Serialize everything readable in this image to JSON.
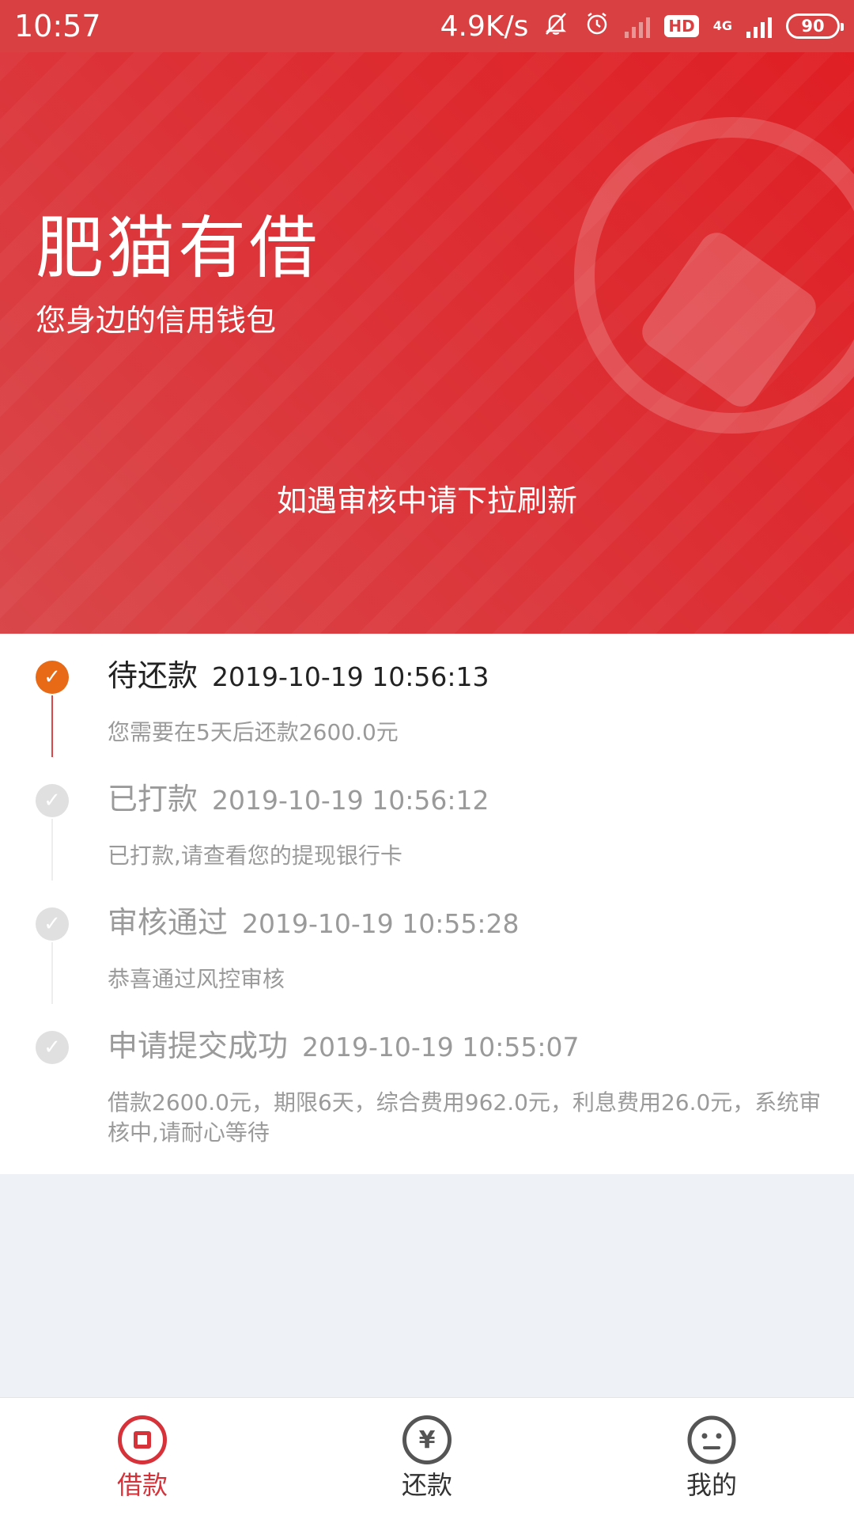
{
  "status_bar": {
    "time": "10:57",
    "network_speed": "4.9K/s",
    "hd": "HD",
    "network_type": "4G",
    "battery": "90"
  },
  "hero": {
    "title": "肥猫有借",
    "subtitle": "您身边的信用钱包",
    "hint": "如遇审核中请下拉刷新"
  },
  "timeline": {
    "items": [
      {
        "title": "待还款",
        "time": "2019-10-19 10:56:13",
        "desc": "您需要在5天后还款2600.0元",
        "active": true
      },
      {
        "title": "已打款",
        "time": "2019-10-19 10:56:12",
        "desc": "已打款,请查看您的提现银行卡",
        "active": false
      },
      {
        "title": "审核通过",
        "time": "2019-10-19 10:55:28",
        "desc": "恭喜通过风控审核",
        "active": false
      },
      {
        "title": "申请提交成功",
        "time": "2019-10-19 10:55:07",
        "desc": "借款2600.0元，期限6天，综合费用962.0元，利息费用26.0元，系统审核中,请耐心等待",
        "active": false
      }
    ]
  },
  "bottom_nav": {
    "items": [
      {
        "label": "借款",
        "icon": "loan-icon",
        "active": true
      },
      {
        "label": "还款",
        "icon": "repay-icon",
        "active": false
      },
      {
        "label": "我的",
        "icon": "profile-icon",
        "active": false
      }
    ]
  },
  "colors": {
    "brand_red": "#dc3136",
    "active_orange": "#e86a16",
    "nav_active": "#d7313a"
  }
}
